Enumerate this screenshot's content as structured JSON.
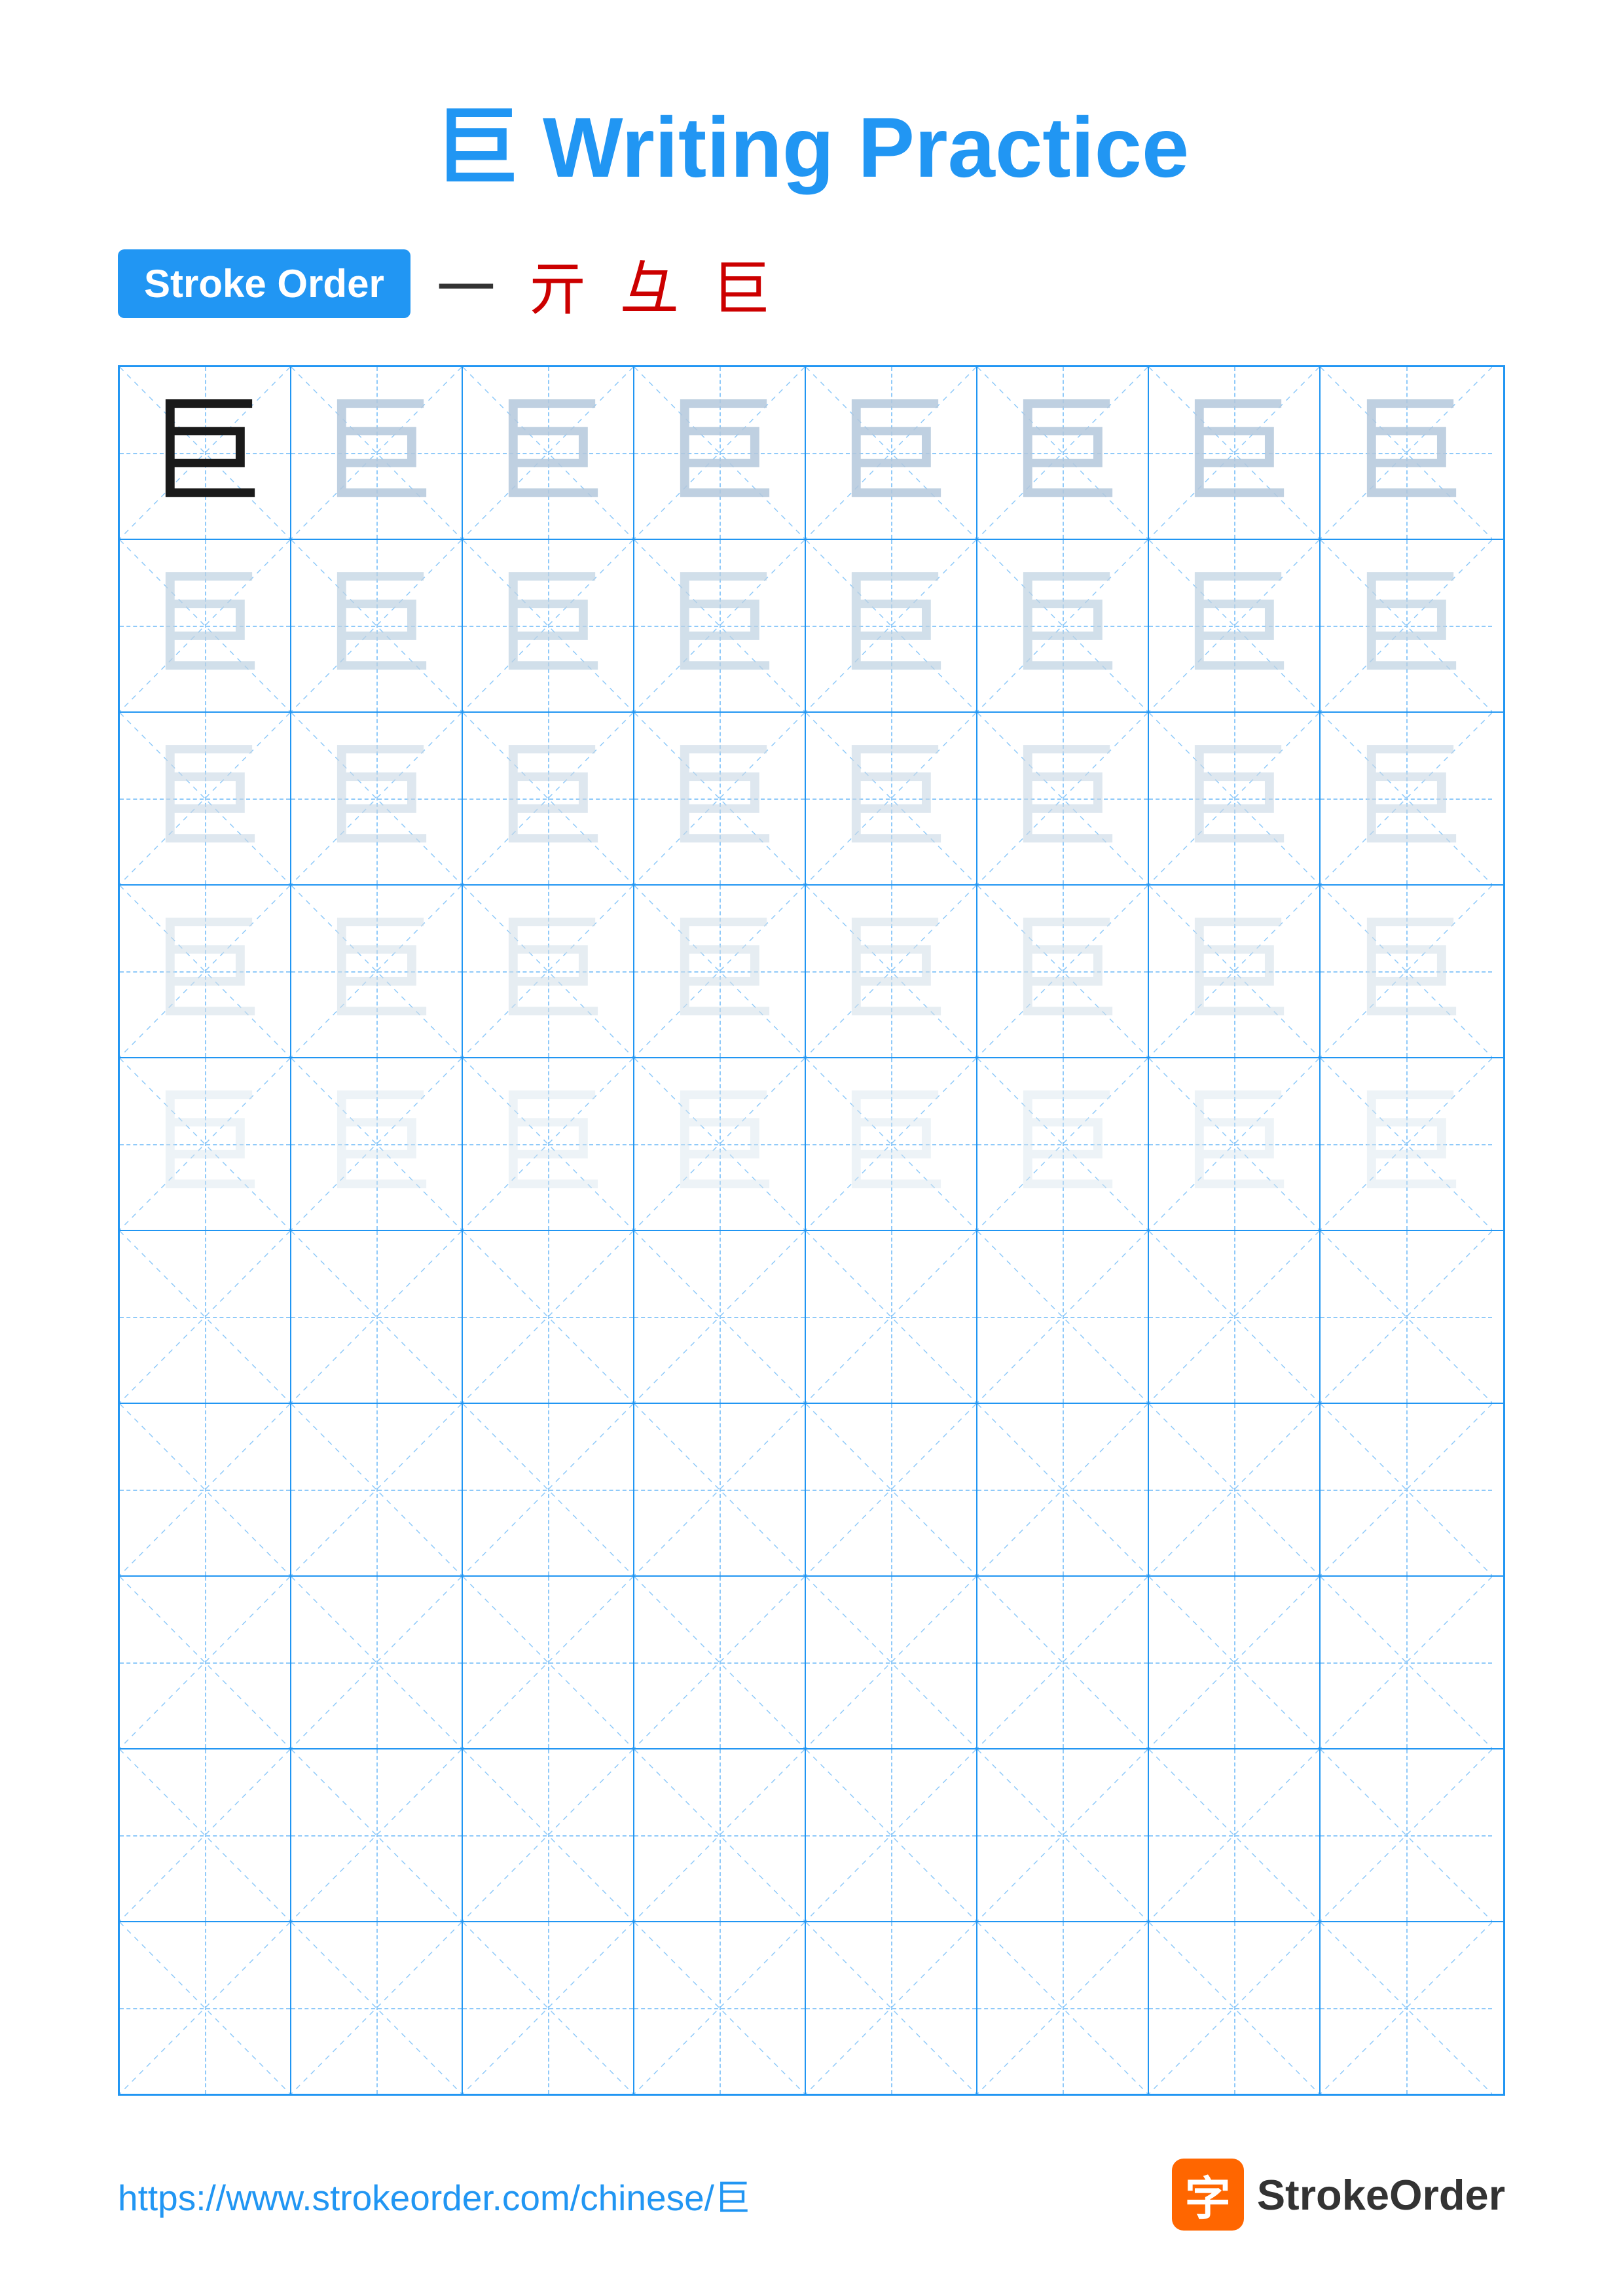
{
  "page": {
    "title": "巨 Writing Practice",
    "character": "巨"
  },
  "stroke_order": {
    "label": "Stroke Order",
    "strokes": [
      "一",
      "亓",
      "彑",
      "巨"
    ]
  },
  "grid": {
    "rows": 10,
    "cols": 8,
    "filled_rows": 5,
    "empty_rows": 5
  },
  "footer": {
    "url": "https://www.strokeorder.com/chinese/巨",
    "brand_icon": "字",
    "brand_name": "StrokeOrder"
  }
}
